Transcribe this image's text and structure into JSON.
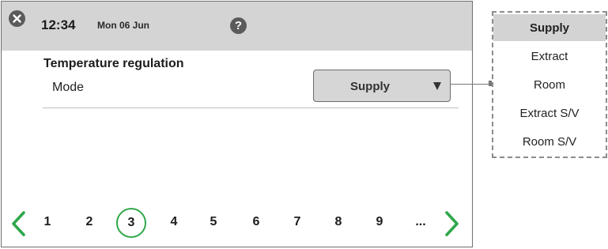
{
  "header": {
    "time": "12:34",
    "date": "Mon 06 Jun",
    "help_label": "?"
  },
  "main": {
    "section_title": "Temperature regulation",
    "mode_label": "Mode",
    "mode_value": "Supply"
  },
  "pagination": {
    "pages": [
      "1",
      "2",
      "3",
      "4",
      "5",
      "6",
      "7",
      "8",
      "9",
      "..."
    ],
    "current_page": "3"
  },
  "dropdown": {
    "options": [
      "Supply",
      "Extract",
      "Room",
      "Extract S/V",
      "Room S/V"
    ],
    "selected": "Supply"
  },
  "colors": {
    "header_bg": "#d4d4d4",
    "accent_green": "#2fa84a",
    "icon_dark": "#5b5b5b"
  },
  "icons": [
    "close-icon",
    "help-icon",
    "caret-down-icon",
    "chevron-left-icon",
    "chevron-right-icon"
  ]
}
